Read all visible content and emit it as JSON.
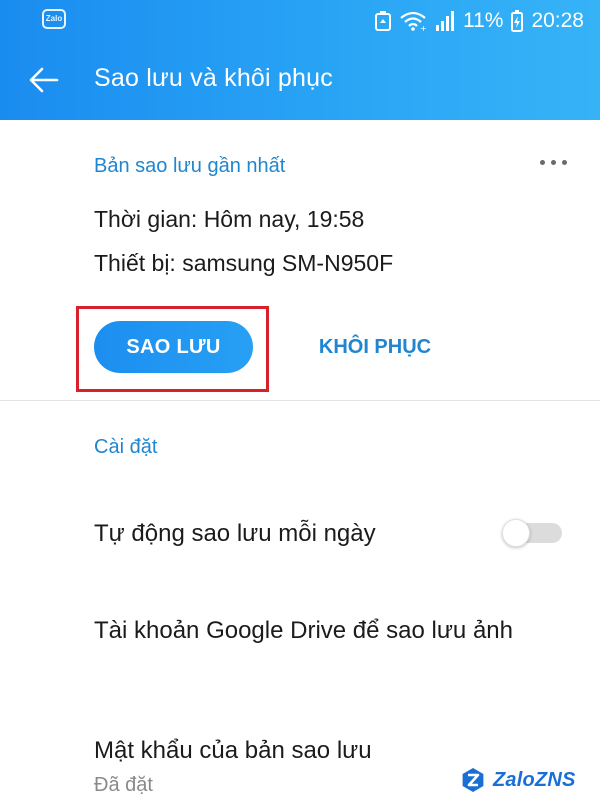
{
  "statusbar": {
    "app_badge": "Zalo",
    "battery_percent": "11%",
    "time": "20:28"
  },
  "appbar": {
    "back_icon": "arrow-left-icon",
    "title": "Sao lưu và khôi phục"
  },
  "backup": {
    "section_title": "Bản sao lưu gần nhất",
    "more_icon": "more-horizontal-icon",
    "time_line": "Thời gian: Hôm nay, 19:58",
    "device_line": "Thiết bị: samsung SM-N950F",
    "backup_button": "SAO LƯU",
    "restore_button": "KHÔI PHỤC"
  },
  "settings": {
    "section_title": "Cài đặt",
    "auto_backup_label": "Tự động sao lưu mỗi ngày",
    "auto_backup_enabled": false,
    "drive_account_label": "Tài khoản Google Drive để sao lưu ảnh",
    "password_label": "Mật khẩu của bản sao lưu",
    "password_status": "Đã đặt"
  },
  "watermark": {
    "text": "ZaloZNS"
  },
  "colors": {
    "header_start": "#1a8cf0",
    "header_end": "#36b3f7",
    "accent_text": "#1f86cf",
    "highlight_border": "#d8202a",
    "toggle_off_track": "#dcdcdc"
  }
}
